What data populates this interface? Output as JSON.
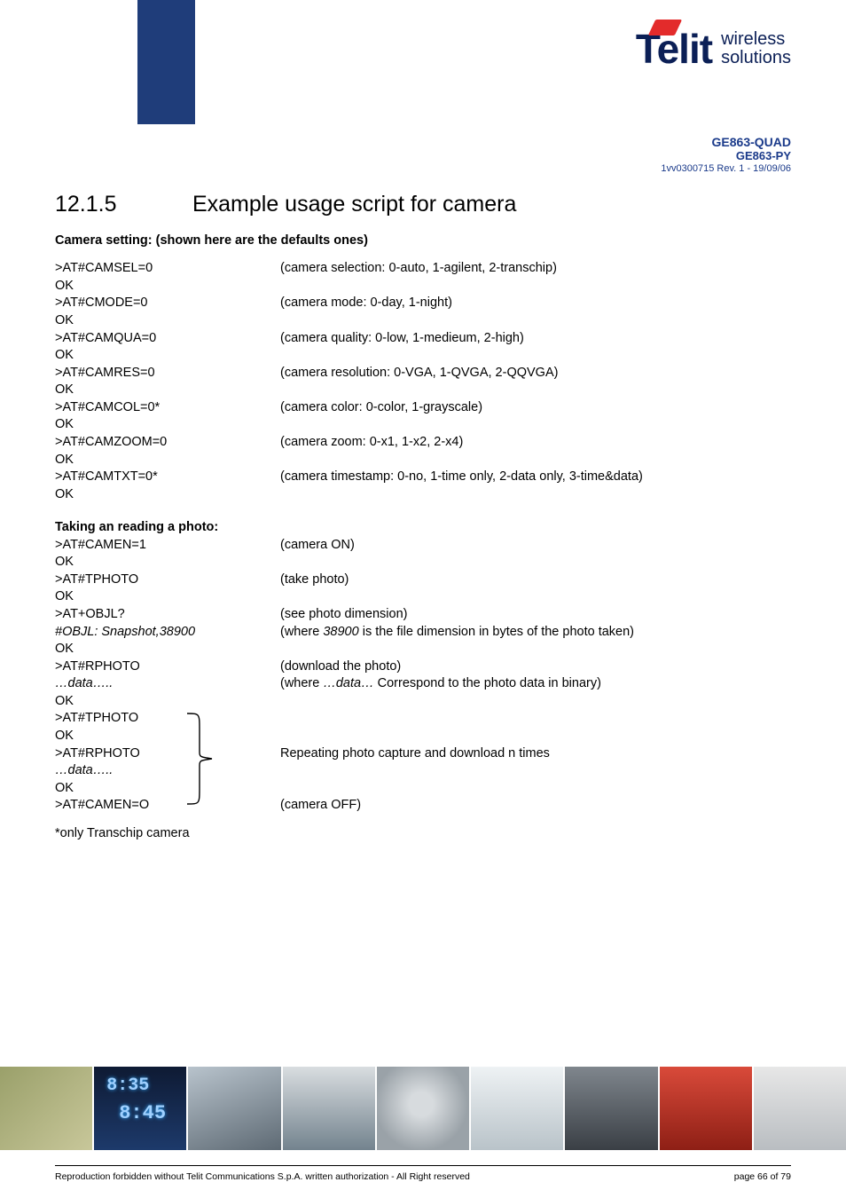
{
  "logo": {
    "brand": "Telit",
    "sub1": "wireless",
    "sub2": "solutions"
  },
  "meta": {
    "m1": "GE863-QUAD",
    "m2": "GE863-PY",
    "m3": "1vv0300715 Rev. 1 - 19/09/06"
  },
  "section": {
    "num": "12.1.5",
    "title": "Example usage script for camera"
  },
  "camset": {
    "heading": "Camera setting: (shown here are the defaults ones)",
    "rows": [
      {
        "cmd": ">AT#CAMSEL=0",
        "desc": "(camera selection: 0-auto, 1-agilent, 2-transchip)"
      },
      {
        "cmd": ">AT#CMODE=0",
        "desc": "(camera mode: 0-day, 1-night)"
      },
      {
        "cmd": ">AT#CAMQUA=0",
        "desc": "(camera quality: 0-low, 1-medieum, 2-high)"
      },
      {
        "cmd": ">AT#CAMRES=0",
        "desc": "(camera resolution: 0-VGA, 1-QVGA, 2-QQVGA)"
      },
      {
        "cmd": ">AT#CAMCOL=0*",
        "desc": "(camera color: 0-color, 1-grayscale)"
      },
      {
        "cmd": ">AT#CAMZOOM=0",
        "desc": "(camera zoom: 0-x1, 1-x2, 2-x4)"
      },
      {
        "cmd": ">AT#CAMTXT=0*",
        "desc": "(camera timestamp: 0-no, 1-time only, 2-data only, 3-time&data)"
      }
    ],
    "ok": "OK"
  },
  "taking": {
    "heading": "Taking an reading a photo:",
    "r1": {
      "cmd": ">AT#CAMEN=1",
      "desc": "(camera ON)"
    },
    "r2": {
      "cmd": ">AT#TPHOTO",
      "desc": "(take photo)"
    },
    "r3": {
      "cmd": ">AT+OBJL?",
      "desc": "(see photo dimension)"
    },
    "r3b": {
      "cmd_pre": "#OBJL: Snapshot,",
      "cmd_val": "38900",
      "desc_pre": "(where ",
      "desc_val": "38900",
      "desc_post": " is the file dimension in bytes of the photo taken)"
    },
    "r4": {
      "cmd": ">AT#RPHOTO",
      "desc": "(download the photo)"
    },
    "r4b": {
      "cmd_pre": "…",
      "cmd_val": "data",
      "cmd_post": "…..",
      "desc_pre": "(where ",
      "desc_val": "…data…",
      "desc_post": "  Correspond to the photo data in binary)"
    },
    "r5": {
      "cmd": ">AT#TPHOTO"
    },
    "r6": {
      "cmd": ">AT#RPHOTO",
      "desc": "Repeating photo capture and download n times"
    },
    "r6b": {
      "cmd_pre": "…",
      "cmd_val": "data",
      "cmd_post": "….."
    },
    "r7": {
      "cmd": ">AT#CAMEN=O",
      "desc": "(camera OFF)"
    },
    "ok": "OK"
  },
  "footnote": "*only Transchip camera",
  "footer": {
    "left": "Reproduction forbidden without Telit Communications S.p.A. written authorization - All Right reserved",
    "right": "page 66 of 79"
  }
}
